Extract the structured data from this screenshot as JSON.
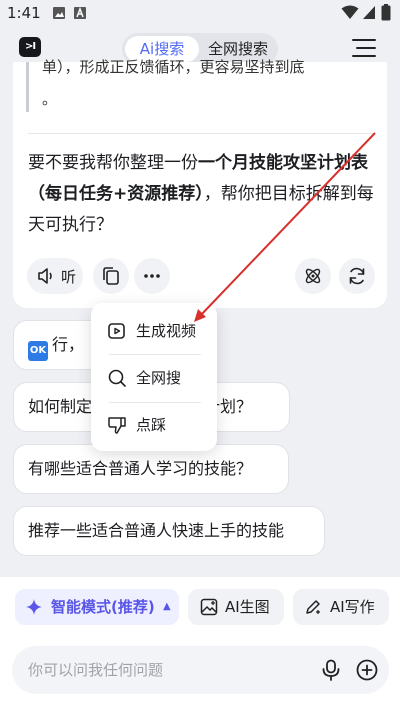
{
  "status_bar": {
    "time": "1:41"
  },
  "header": {
    "logo_text": ">I",
    "tabs": [
      {
        "label": "Ai搜索",
        "active": true
      },
      {
        "label": "全网搜索",
        "active": false
      }
    ]
  },
  "chat": {
    "quote_line1": "单），形成正反馈循环，更容易坚持到底",
    "quote_line2": "。",
    "message": {
      "part1": "要不要我帮你整理一份",
      "bold": "一个月技能攻坚计划表（每日任务+资源推荐）",
      "part2": "，帮你把目标拆解到每天可执行？"
    },
    "listen_label": "听"
  },
  "popup_menu": [
    {
      "label": "生成视频",
      "icon": "video-play-icon"
    },
    {
      "label": "全网搜",
      "icon": "search-icon"
    },
    {
      "label": "点踩",
      "icon": "thumb-down-icon"
    }
  ],
  "suggestions": [
    {
      "badge": "OK",
      "text": "行，"
    },
    {
      "text": "如何制定一个月技能攻坚计划？"
    },
    {
      "text": "有哪些适合普通人学习的技能？"
    },
    {
      "text": "推荐一些适合普通人快速上手的技能"
    }
  ],
  "modes": {
    "smart": "智能模式(推荐)",
    "image": "AI生图",
    "write": "AI写作"
  },
  "input": {
    "placeholder": "你可以问我任何问题"
  },
  "colors": {
    "accent": "#4f6bf5",
    "smart_mode": "#5a57e8",
    "annotation_arrow": "#d9302c"
  }
}
